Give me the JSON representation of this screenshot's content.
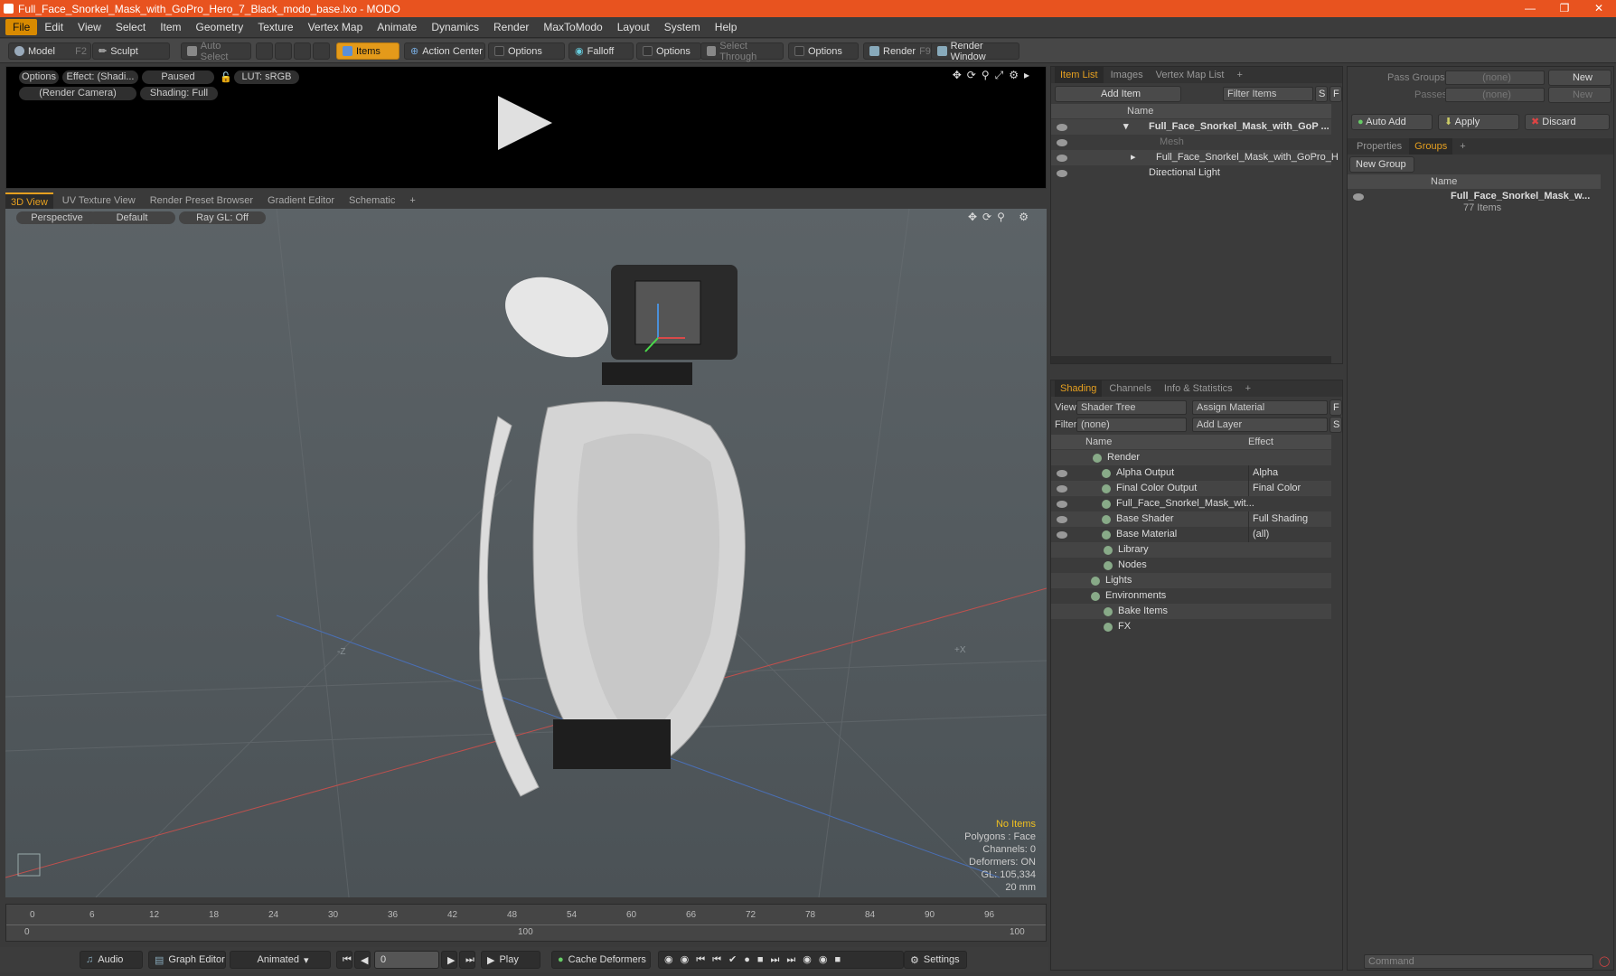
{
  "window": {
    "title": "Full_Face_Snorkel_Mask_with_GoPro_Hero_7_Black_modo_base.lxo - MODO"
  },
  "menu": [
    "File",
    "Edit",
    "View",
    "Select",
    "Item",
    "Geometry",
    "Texture",
    "Vertex Map",
    "Animate",
    "Dynamics",
    "Render",
    "MaxToModo",
    "Layout",
    "System",
    "Help"
  ],
  "toolbar": {
    "model": "Model",
    "model_key": "F2",
    "sculpt": "Sculpt",
    "auto_select": "Auto Select",
    "items": "Items",
    "action_center": "Action Center",
    "options1": "Options",
    "falloff": "Falloff",
    "options2": "Options",
    "select_through": "Select Through",
    "options3": "Options",
    "render": "Render",
    "render_key": "F9",
    "render_window": "Render Window"
  },
  "render_preview": {
    "options": "Options",
    "effect": "Effect: (Shadi...",
    "paused": "Paused",
    "lut": "LUT: sRGB",
    "camera": "(Render Camera)",
    "shading": "Shading: Full"
  },
  "view_tabs": [
    "3D View",
    "UV Texture View",
    "Render Preset Browser",
    "Gradient Editor",
    "Schematic",
    "+"
  ],
  "viewport": {
    "perspective": "Perspective",
    "default": "Default",
    "raygl": "Ray GL: Off",
    "axis_neg": "-Z",
    "axis_pos": "+X"
  },
  "stats": {
    "selection": "No Items",
    "polygons": "Polygons : Face",
    "channels": "Channels: 0",
    "deformers": "Deformers: ON",
    "gl": "GL: 105,334",
    "scale": "20 mm"
  },
  "timeline": {
    "ticks": [
      "0",
      "6",
      "12",
      "18",
      "24",
      "30",
      "36",
      "42",
      "48",
      "54",
      "60",
      "66",
      "72",
      "78",
      "84",
      "90",
      "96"
    ],
    "lower": [
      "0",
      "100",
      "100"
    ]
  },
  "bottom": {
    "audio": "Audio",
    "graph_editor": "Graph Editor",
    "animated": "Animated",
    "frame": "0",
    "play": "Play",
    "cache": "Cache Deformers",
    "settings": "Settings"
  },
  "item_list": {
    "tabs": [
      "Item List",
      "Images",
      "Vertex Map List",
      "+"
    ],
    "add_item": "Add Item",
    "filter": "Filter Items",
    "s": "S",
    "f": "F",
    "col_name": "Name",
    "rows": [
      "Full_Face_Snorkel_Mask_with_GoP ...",
      "Mesh",
      "Full_Face_Snorkel_Mask_with_GoPro_H ...",
      "Directional Light"
    ]
  },
  "shading": {
    "tabs": [
      "Shading",
      "Channels",
      "Info & Statistics",
      "+"
    ],
    "view_label": "View",
    "view_value": "Shader Tree",
    "assign": "Assign Material",
    "f": "F",
    "filter_label": "Filter",
    "filter_value": "(none)",
    "add_layer": "Add Layer",
    "s": "S",
    "col_name": "Name",
    "col_effect": "Effect",
    "rows": [
      {
        "name": "Render",
        "effect": ""
      },
      {
        "name": "Alpha Output",
        "effect": "Alpha"
      },
      {
        "name": "Final Color Output",
        "effect": "Final Color"
      },
      {
        "name": "Full_Face_Snorkel_Mask_wit...",
        "effect": ""
      },
      {
        "name": "Base Shader",
        "effect": "Full Shading"
      },
      {
        "name": "Base Material",
        "effect": "(all)"
      },
      {
        "name": "Library",
        "effect": ""
      },
      {
        "name": "Nodes",
        "effect": ""
      },
      {
        "name": "Lights",
        "effect": ""
      },
      {
        "name": "Environments",
        "effect": ""
      },
      {
        "name": "Bake Items",
        "effect": ""
      },
      {
        "name": "FX",
        "effect": ""
      }
    ]
  },
  "groups_panel": {
    "pass_groups": "Pass Groups",
    "passes": "Passes",
    "none1": "(none)",
    "none2": "(none)",
    "new1": "New",
    "new2": "New",
    "auto_add": "Auto Add",
    "apply": "Apply",
    "discard": "Discard",
    "tabs": [
      "Properties",
      "Groups",
      "+"
    ],
    "new_group": "New Group",
    "col_name": "Name",
    "group_name": "Full_Face_Snorkel_Mask_w...",
    "group_count": "77 Items",
    "command": "Command"
  },
  "colors": {
    "accent": "#e6a020",
    "titlebar": "#e8531f"
  }
}
